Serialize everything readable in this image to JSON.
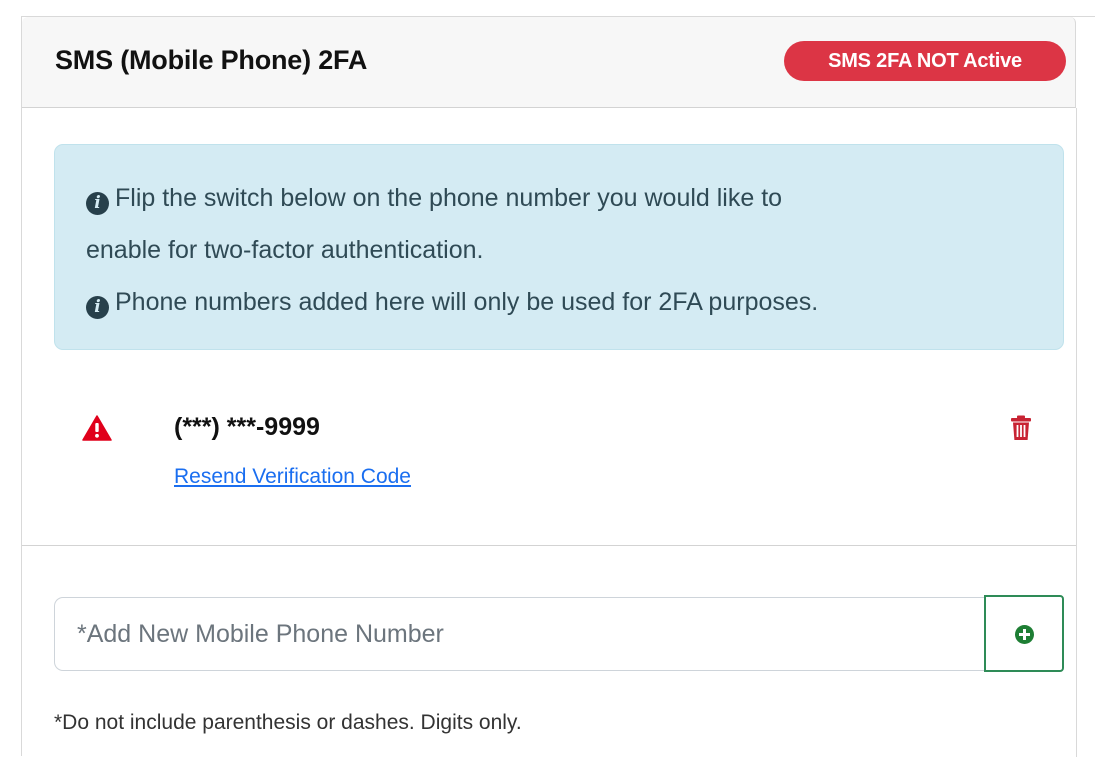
{
  "card": {
    "title": "SMS (Mobile Phone) 2FA",
    "status_badge": "SMS 2FA NOT Active",
    "status_color": "#dc3545"
  },
  "info_alert": {
    "line1": "Flip the switch below on the phone number you would like to",
    "line2": "enable for two-factor authentication.",
    "line3": "Phone numbers added here will only be used for 2FA purposes.",
    "icon": "info-circle-icon"
  },
  "phone_entry": {
    "number": "(***) ***-9999",
    "resend_link": "Resend Verification Code",
    "status_icon": "warning-triangle-icon",
    "delete_icon": "trash-icon",
    "warning_color": "#e0001b"
  },
  "add_phone": {
    "placeholder": "*Add New Mobile Phone Number",
    "value": "",
    "button_icon": "plus-circle-icon",
    "button_color": "#2e8b57",
    "help_text": "*Do not include parenthesis or dashes. Digits only."
  }
}
